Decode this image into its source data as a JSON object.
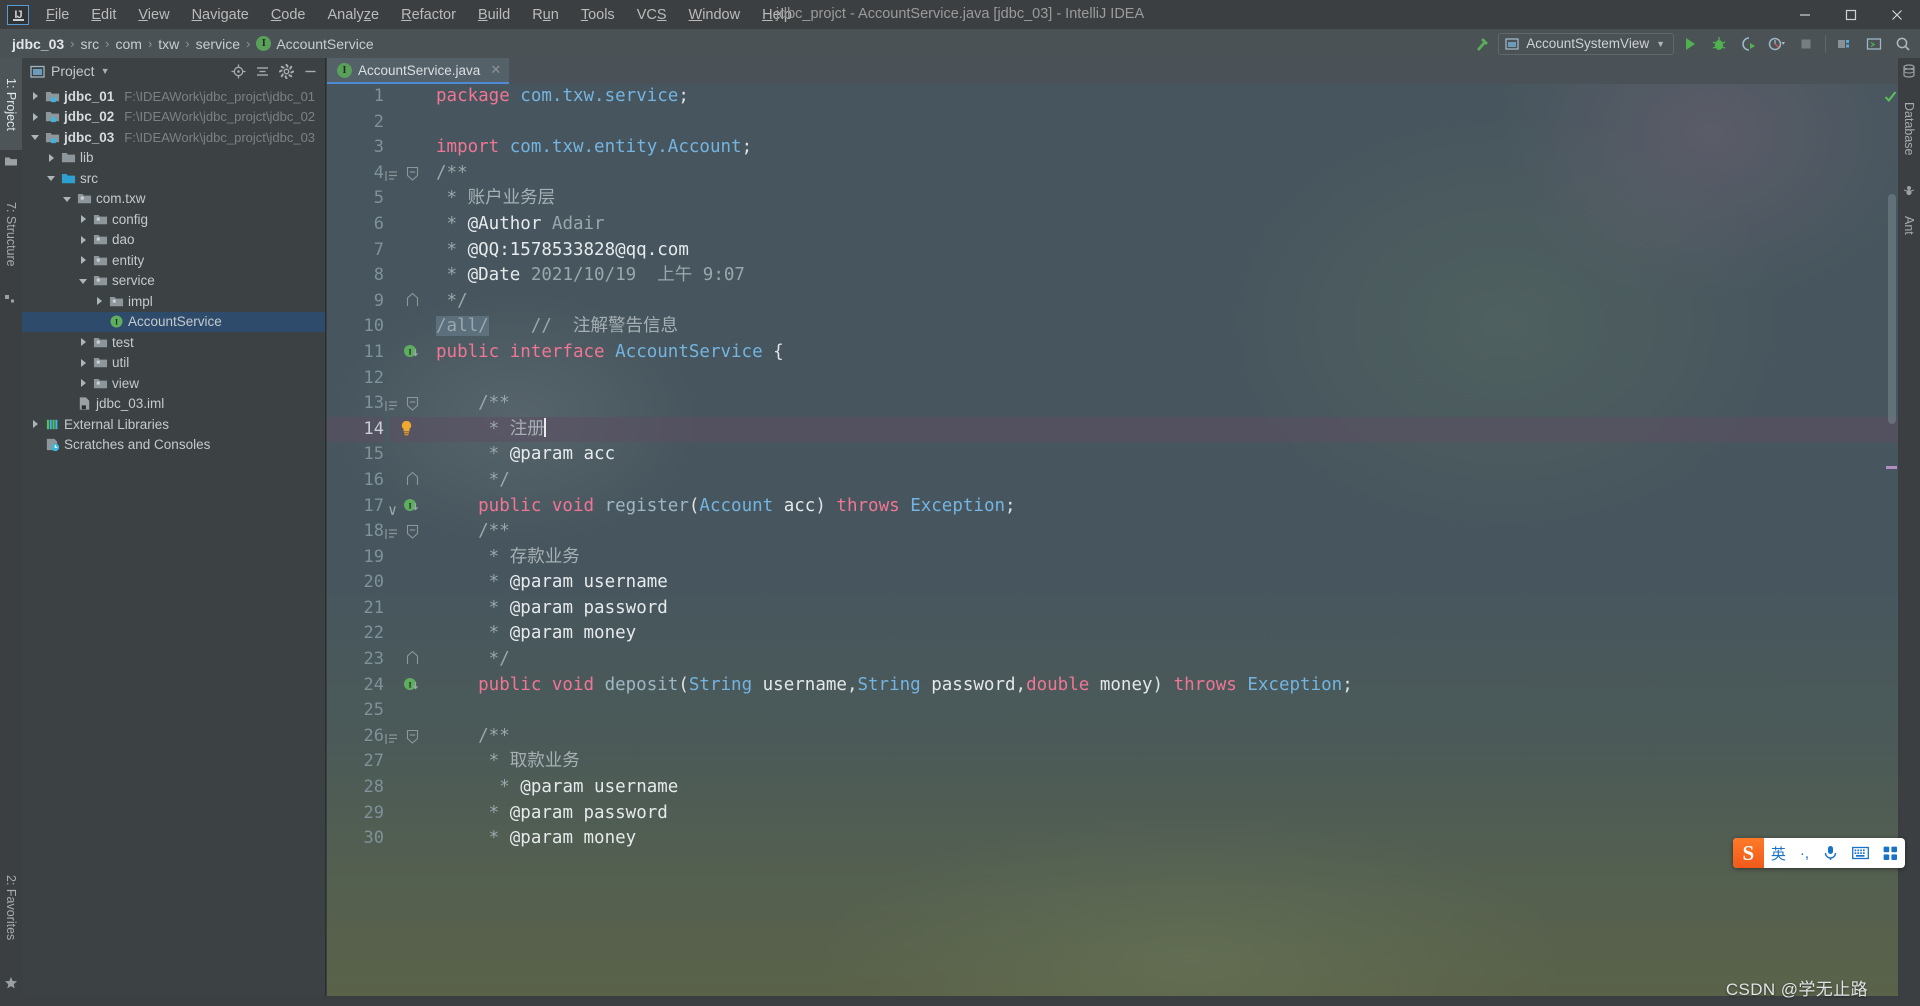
{
  "window": {
    "title": "jdbc_projct - AccountService.java [jdbc_03] - IntelliJ IDEA",
    "logo_text": "IJ",
    "minimize": "–",
    "maximize": "❐",
    "close": "✕"
  },
  "menu": {
    "items": [
      {
        "label": "File",
        "mnemonic": "F"
      },
      {
        "label": "Edit",
        "mnemonic": "E"
      },
      {
        "label": "View",
        "mnemonic": "V"
      },
      {
        "label": "Navigate",
        "mnemonic": "N"
      },
      {
        "label": "Code",
        "mnemonic": "C"
      },
      {
        "label": "Analyze",
        "mnemonic": "z"
      },
      {
        "label": "Refactor",
        "mnemonic": "R"
      },
      {
        "label": "Build",
        "mnemonic": "B"
      },
      {
        "label": "Run",
        "mnemonic": "u"
      },
      {
        "label": "Tools",
        "mnemonic": "T"
      },
      {
        "label": "VCS",
        "mnemonic": "S"
      },
      {
        "label": "Window",
        "mnemonic": "W"
      },
      {
        "label": "Help",
        "mnemonic": "H"
      }
    ]
  },
  "breadcrumb": {
    "separator": "›",
    "items": [
      {
        "label": "jdbc_03",
        "type": "module"
      },
      {
        "label": "src",
        "type": "folder"
      },
      {
        "label": "com",
        "type": "folder"
      },
      {
        "label": "txw",
        "type": "folder"
      },
      {
        "label": "service",
        "type": "folder"
      },
      {
        "label": "AccountService",
        "type": "interface",
        "badge": "I"
      }
    ]
  },
  "toolbar": {
    "run_configuration": "AccountSystemView",
    "dropdown_caret": "▼",
    "buttons": [
      {
        "name": "run-button",
        "glyph": "▶",
        "label": "Run"
      },
      {
        "name": "debug-button",
        "glyph": "bug",
        "label": "Debug"
      },
      {
        "name": "run-with-coverage-button",
        "glyph": "coverage",
        "label": "Run with Coverage"
      },
      {
        "name": "profile-button",
        "glyph": "profile",
        "label": "Profile"
      },
      {
        "name": "stop-button",
        "glyph": "■",
        "label": "Stop"
      },
      {
        "name": "project-structure-button",
        "glyph": "structure",
        "label": "Project Structure"
      },
      {
        "name": "terminal-button",
        "glyph": "terminal",
        "label": "Terminal"
      },
      {
        "name": "search-everywhere-button",
        "glyph": "⌕",
        "label": "Search Everywhere"
      }
    ]
  },
  "left_tool_strip": {
    "tabs": [
      {
        "label": "1: Project",
        "mnemonic": "1",
        "active": true,
        "icon": "project-icon"
      },
      {
        "label": "7: Structure",
        "mnemonic": "7",
        "active": false,
        "icon": "structure-icon"
      },
      {
        "label": "2: Favorites",
        "mnemonic": "2",
        "active": false,
        "icon": "star-icon"
      }
    ]
  },
  "right_tool_strip": {
    "tabs": [
      {
        "label": "Database",
        "icon": "database-icon"
      },
      {
        "label": "Ant",
        "icon": "ant-icon"
      }
    ]
  },
  "project_panel": {
    "title": "Project",
    "title_caret": "▼",
    "actions": [
      {
        "name": "locate-file-button",
        "glyph": "target"
      },
      {
        "name": "collapse-all-button",
        "glyph": "collapse"
      },
      {
        "name": "settings-gear-button",
        "glyph": "gear"
      },
      {
        "name": "hide-panel-button",
        "glyph": "minus"
      }
    ],
    "tree": [
      {
        "indent": 0,
        "arrow": "right",
        "icon": "module-icon",
        "label": "jdbc_01",
        "bold": true,
        "path": "F:\\IDEAWork\\jdbc_projct\\jdbc_01",
        "selected": false
      },
      {
        "indent": 0,
        "arrow": "right",
        "icon": "module-icon",
        "label": "jdbc_02",
        "bold": true,
        "path": "F:\\IDEAWork\\jdbc_projct\\jdbc_02",
        "selected": false
      },
      {
        "indent": 0,
        "arrow": "down",
        "icon": "module-icon",
        "label": "jdbc_03",
        "bold": true,
        "path": "F:\\IDEAWork\\jdbc_projct\\jdbc_03",
        "selected": false
      },
      {
        "indent": 1,
        "arrow": "right",
        "icon": "folder-icon",
        "label": "lib",
        "bold": false,
        "path": "",
        "selected": false
      },
      {
        "indent": 1,
        "arrow": "down",
        "icon": "source-folder-icon",
        "label": "src",
        "bold": false,
        "path": "",
        "selected": false
      },
      {
        "indent": 2,
        "arrow": "down",
        "icon": "package-icon",
        "label": "com.txw",
        "bold": false,
        "path": "",
        "selected": false
      },
      {
        "indent": 3,
        "arrow": "right",
        "icon": "package-icon",
        "label": "config",
        "bold": false,
        "path": "",
        "selected": false
      },
      {
        "indent": 3,
        "arrow": "right",
        "icon": "package-icon",
        "label": "dao",
        "bold": false,
        "path": "",
        "selected": false
      },
      {
        "indent": 3,
        "arrow": "right",
        "icon": "package-icon",
        "label": "entity",
        "bold": false,
        "path": "",
        "selected": false
      },
      {
        "indent": 3,
        "arrow": "down",
        "icon": "package-icon",
        "label": "service",
        "bold": false,
        "path": "",
        "selected": false
      },
      {
        "indent": 4,
        "arrow": "right",
        "icon": "package-icon",
        "label": "impl",
        "bold": false,
        "path": "",
        "selected": false
      },
      {
        "indent": 4,
        "arrow": "none",
        "icon": "interface-icon",
        "label": "AccountService",
        "bold": false,
        "path": "",
        "selected": true
      },
      {
        "indent": 3,
        "arrow": "right",
        "icon": "package-icon",
        "label": "test",
        "bold": false,
        "path": "",
        "selected": false
      },
      {
        "indent": 3,
        "arrow": "right",
        "icon": "package-icon",
        "label": "util",
        "bold": false,
        "path": "",
        "selected": false
      },
      {
        "indent": 3,
        "arrow": "right",
        "icon": "package-icon",
        "label": "view",
        "bold": false,
        "path": "",
        "selected": false
      },
      {
        "indent": 2,
        "arrow": "none",
        "icon": "iml-file-icon",
        "label": "jdbc_03.iml",
        "bold": false,
        "path": "",
        "selected": false
      },
      {
        "indent": 0,
        "arrow": "right",
        "icon": "libraries-icon",
        "label": "External Libraries",
        "bold": false,
        "path": "",
        "selected": false
      },
      {
        "indent": 0,
        "arrow": "none",
        "icon": "scratches-icon",
        "label": "Scratches and Consoles",
        "bold": false,
        "path": "",
        "selected": false
      }
    ]
  },
  "editor": {
    "tab": {
      "label": "AccountService.java",
      "badge": "I",
      "close_glyph": "✕"
    },
    "current_line": 14,
    "lines": [
      {
        "n": 1,
        "tokens": [
          {
            "t": "package ",
            "c": "kw"
          },
          {
            "t": "com.txw.service",
            "c": "type"
          },
          {
            "t": ";",
            "c": "punc"
          }
        ],
        "indent": 0
      },
      {
        "n": 2,
        "tokens": [],
        "indent": 0
      },
      {
        "n": 3,
        "tokens": [
          {
            "t": "import ",
            "c": "kw"
          },
          {
            "t": "com.txw.entity.Account",
            "c": "type"
          },
          {
            "t": ";",
            "c": "punc"
          }
        ],
        "indent": 0
      },
      {
        "n": 4,
        "tokens": [
          {
            "t": "/**",
            "c": "cmt"
          }
        ],
        "indent": 0,
        "fold": "start",
        "guide": true
      },
      {
        "n": 5,
        "tokens": [
          {
            "t": " * ",
            "c": "cmt"
          },
          {
            "t": "账户业务层",
            "c": "cmt-cn"
          }
        ],
        "indent": 0
      },
      {
        "n": 6,
        "tokens": [
          {
            "t": " * ",
            "c": "cmt"
          },
          {
            "t": "@Author",
            "c": "cmt-tag"
          },
          {
            "t": " Adair",
            "c": "cmt"
          }
        ],
        "indent": 0
      },
      {
        "n": 7,
        "tokens": [
          {
            "t": " * ",
            "c": "cmt"
          },
          {
            "t": "@QQ:1578533828@qq.com",
            "c": "cmt-tag"
          }
        ],
        "indent": 0
      },
      {
        "n": 8,
        "tokens": [
          {
            "t": " * ",
            "c": "cmt"
          },
          {
            "t": "@Date",
            "c": "cmt-tag"
          },
          {
            "t": " 2021/10/19  上午 9:07",
            "c": "cmt"
          }
        ],
        "indent": 0
      },
      {
        "n": 9,
        "tokens": [
          {
            "t": " */",
            "c": "cmt"
          }
        ],
        "indent": 0,
        "fold": "end"
      },
      {
        "n": 10,
        "tokens": [
          {
            "t": "/all/",
            "c": "cmt hl-tok"
          },
          {
            "t": "    // ",
            "c": "cmt"
          },
          {
            "t": " 注解警告信息",
            "c": "cmt-cn"
          }
        ],
        "indent": 0
      },
      {
        "n": 11,
        "tokens": [
          {
            "t": "public interface ",
            "c": "kw"
          },
          {
            "t": "AccountService",
            "c": "type"
          },
          {
            "t": " {",
            "c": "punc"
          }
        ],
        "indent": 0,
        "gutter_icon": "implemented-interface-icon"
      },
      {
        "n": 12,
        "tokens": [],
        "indent": 0
      },
      {
        "n": 13,
        "tokens": [
          {
            "t": "    /**",
            "c": "cmt"
          }
        ],
        "indent": 0,
        "fold": "start",
        "guide": true
      },
      {
        "n": 14,
        "tokens": [
          {
            "t": "     * ",
            "c": "cmt"
          },
          {
            "t": "注册",
            "c": "cmt-cn"
          }
        ],
        "indent": 0,
        "gutter_icon": "intention-bulb-icon",
        "caret": true
      },
      {
        "n": 15,
        "tokens": [
          {
            "t": "     * ",
            "c": "cmt"
          },
          {
            "t": "@param",
            "c": "cmt-tag"
          },
          {
            "t": " acc",
            "c": "cmt-tag"
          }
        ],
        "indent": 0
      },
      {
        "n": 16,
        "tokens": [
          {
            "t": "     */",
            "c": "cmt"
          }
        ],
        "indent": 0,
        "fold": "end"
      },
      {
        "n": 17,
        "tokens": [
          {
            "t": "    public void ",
            "c": "kw"
          },
          {
            "t": "register",
            "c": "method"
          },
          {
            "t": "(",
            "c": "punc"
          },
          {
            "t": "Account",
            "c": "type"
          },
          {
            "t": " acc",
            "c": "ident"
          },
          {
            "t": ") ",
            "c": "punc"
          },
          {
            "t": "throws ",
            "c": "kw"
          },
          {
            "t": "Exception",
            "c": "type"
          },
          {
            "t": ";",
            "c": "punc"
          }
        ],
        "indent": 0,
        "gutter_icon": "implemented-method-icon",
        "chevron": true
      },
      {
        "n": 18,
        "tokens": [
          {
            "t": "    /**",
            "c": "cmt"
          }
        ],
        "indent": 0,
        "fold": "start",
        "guide": true
      },
      {
        "n": 19,
        "tokens": [
          {
            "t": "     * ",
            "c": "cmt"
          },
          {
            "t": "存款业务",
            "c": "cmt-cn"
          }
        ],
        "indent": 0
      },
      {
        "n": 20,
        "tokens": [
          {
            "t": "     * ",
            "c": "cmt"
          },
          {
            "t": "@param",
            "c": "cmt-tag"
          },
          {
            "t": " username",
            "c": "cmt-tag"
          }
        ],
        "indent": 0
      },
      {
        "n": 21,
        "tokens": [
          {
            "t": "     * ",
            "c": "cmt"
          },
          {
            "t": "@param",
            "c": "cmt-tag"
          },
          {
            "t": " password",
            "c": "cmt-tag"
          }
        ],
        "indent": 0
      },
      {
        "n": 22,
        "tokens": [
          {
            "t": "     * ",
            "c": "cmt"
          },
          {
            "t": "@param",
            "c": "cmt-tag"
          },
          {
            "t": " money",
            "c": "cmt-tag"
          }
        ],
        "indent": 0
      },
      {
        "n": 23,
        "tokens": [
          {
            "t": "     */",
            "c": "cmt"
          }
        ],
        "indent": 0,
        "fold": "end"
      },
      {
        "n": 24,
        "tokens": [
          {
            "t": "    public void ",
            "c": "kw"
          },
          {
            "t": "deposit",
            "c": "method"
          },
          {
            "t": "(",
            "c": "punc"
          },
          {
            "t": "String",
            "c": "type"
          },
          {
            "t": " username",
            "c": "ident"
          },
          {
            "t": ",",
            "c": "punc"
          },
          {
            "t": "String",
            "c": "type"
          },
          {
            "t": " password",
            "c": "ident"
          },
          {
            "t": ",",
            "c": "punc"
          },
          {
            "t": "double",
            "c": "kw"
          },
          {
            "t": " money",
            "c": "ident"
          },
          {
            "t": ") ",
            "c": "punc"
          },
          {
            "t": "throws ",
            "c": "kw"
          },
          {
            "t": "Exception",
            "c": "type"
          },
          {
            "t": ";",
            "c": "punc"
          }
        ],
        "indent": 0,
        "gutter_icon": "implemented-method-icon"
      },
      {
        "n": 25,
        "tokens": [],
        "indent": 0
      },
      {
        "n": 26,
        "tokens": [
          {
            "t": "    /**",
            "c": "cmt"
          }
        ],
        "indent": 0,
        "fold": "start",
        "guide": true
      },
      {
        "n": 27,
        "tokens": [
          {
            "t": "     * ",
            "c": "cmt"
          },
          {
            "t": "取款业务",
            "c": "cmt-cn"
          }
        ],
        "indent": 0
      },
      {
        "n": 28,
        "tokens": [
          {
            "t": "      * ",
            "c": "cmt"
          },
          {
            "t": "@param",
            "c": "cmt-tag"
          },
          {
            "t": " username",
            "c": "cmt-tag"
          }
        ],
        "indent": 0
      },
      {
        "n": 29,
        "tokens": [
          {
            "t": "     * ",
            "c": "cmt"
          },
          {
            "t": "@param",
            "c": "cmt-tag"
          },
          {
            "t": " password",
            "c": "cmt-tag"
          }
        ],
        "indent": 0
      },
      {
        "n": 30,
        "tokens": [
          {
            "t": "     * ",
            "c": "cmt"
          },
          {
            "t": "@param",
            "c": "cmt-tag"
          },
          {
            "t": " money",
            "c": "cmt-tag"
          }
        ],
        "indent": 0
      }
    ]
  },
  "ime": {
    "logo": "S",
    "items": [
      {
        "name": "ime-language-toggle",
        "label": "英"
      },
      {
        "name": "ime-punctuation-toggle",
        "label": "·,"
      },
      {
        "name": "ime-voice-input",
        "label": "🎤"
      },
      {
        "name": "ime-soft-keyboard",
        "label": "⌨"
      },
      {
        "name": "ime-toolbox",
        "label": "⬚"
      }
    ]
  },
  "watermark": "CSDN @学无止路",
  "colors": {
    "accent_blue": "#4f8bd4",
    "keyword_pink": "#f07694",
    "type_blue": "#74b4e0",
    "comment_gray": "#9aa7ab",
    "selection_blue": "#2e4b6b",
    "current_line": "#5c4e63",
    "run_green": "#4caf50",
    "ime_orange": "#f1591a"
  }
}
